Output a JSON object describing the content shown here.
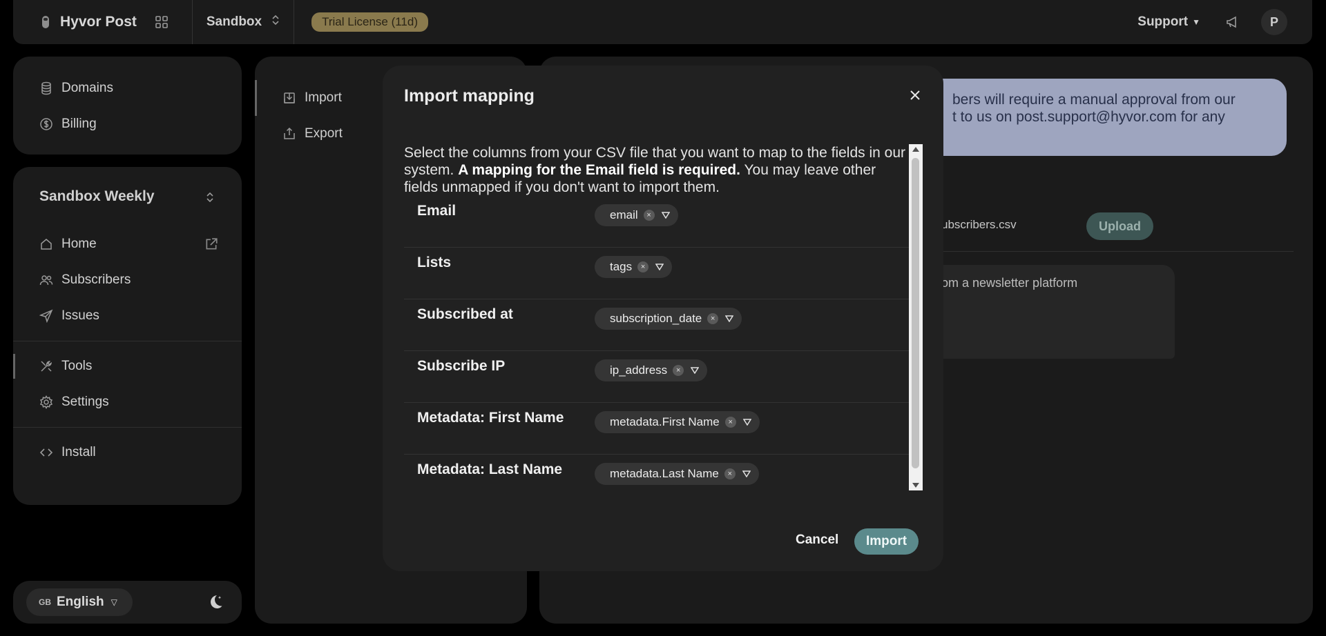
{
  "topbar": {
    "brand_name": "Hyvor Post",
    "org_name": "Sandbox",
    "trial_badge": "Trial License (11d)",
    "support_label": "Support",
    "avatar_initial": "P"
  },
  "sidebar": {
    "top_items": [
      {
        "label": "Domains",
        "icon": "database-icon"
      },
      {
        "label": "Billing",
        "icon": "dollar-circle-icon"
      }
    ],
    "newsletter_name": "Sandbox Weekly",
    "main_items": [
      {
        "label": "Home",
        "icon": "home-icon"
      },
      {
        "label": "Subscribers",
        "icon": "users-icon"
      },
      {
        "label": "Issues",
        "icon": "send-icon"
      }
    ],
    "tool_items": [
      {
        "label": "Tools",
        "icon": "tools-icon",
        "active": true
      },
      {
        "label": "Settings",
        "icon": "gear-icon"
      }
    ],
    "install_label": "Install",
    "language_flag": "GB",
    "language_label": "English"
  },
  "tools_nav": {
    "items": [
      {
        "label": "Import",
        "icon": "import-icon",
        "active": true
      },
      {
        "label": "Export",
        "icon": "export-icon"
      }
    ]
  },
  "content": {
    "notice_line1": "bers will require a manual approval from our",
    "notice_line2": "t to us on post.support@hyvor.com for any",
    "file_name": "ubscribers.csv",
    "upload_label": "Upload",
    "textarea_value": "om a newsletter platform"
  },
  "modal": {
    "title": "Import mapping",
    "desc_part1": "Select the columns from your CSV file that you want to map to the fields in our system. ",
    "desc_bold": "A mapping for the Email field is required.",
    "desc_part2": " You may leave other fields unmapped if you don't want to import them.",
    "rows": [
      {
        "label": "Email",
        "value": "email"
      },
      {
        "label": "Lists",
        "value": "tags"
      },
      {
        "label": "Subscribed at",
        "value": "subscription_date"
      },
      {
        "label": "Subscribe IP",
        "value": "ip_address"
      },
      {
        "label": "Metadata: First Name",
        "value": "metadata.First Name"
      },
      {
        "label": "Metadata: Last Name",
        "value": "metadata.Last Name"
      }
    ],
    "cancel_label": "Cancel",
    "import_label": "Import"
  },
  "colors": {
    "accent": "#5b8a8c",
    "notice_bg": "#9ea5bf",
    "trial_badge_bg": "#8a7a4d"
  }
}
